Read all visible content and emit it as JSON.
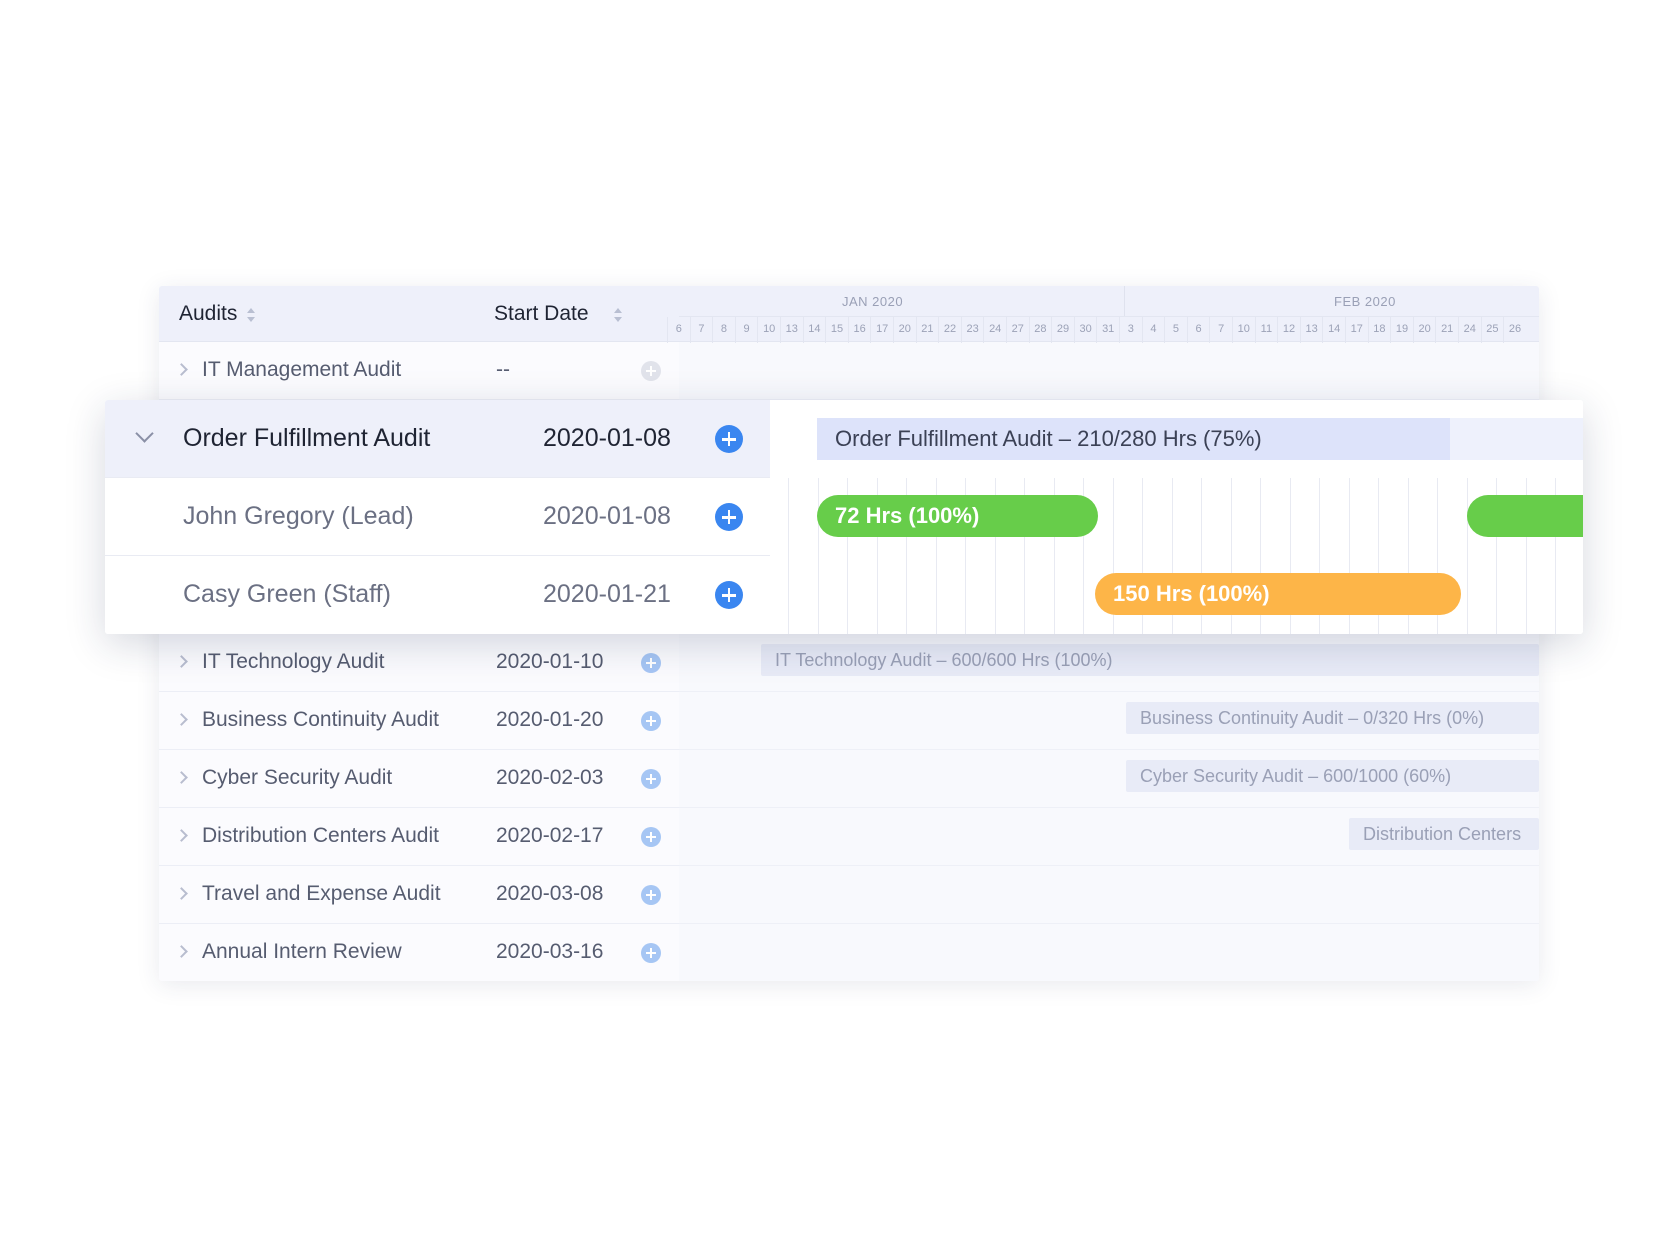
{
  "columns": {
    "audits": "Audits",
    "start_date": "Start Date"
  },
  "timeline": {
    "months": [
      "JAN 2020",
      "FEB 2020"
    ],
    "days": [
      "6",
      "7",
      "8",
      "9",
      "10",
      "13",
      "14",
      "15",
      "16",
      "17",
      "20",
      "21",
      "22",
      "23",
      "24",
      "27",
      "28",
      "29",
      "30",
      "31",
      "3",
      "4",
      "5",
      "6",
      "7",
      "10",
      "11",
      "12",
      "13",
      "14",
      "17",
      "18",
      "19",
      "20",
      "21",
      "24",
      "25",
      "26"
    ]
  },
  "rows_top": [
    {
      "name": "IT Management Audit",
      "date": "--"
    }
  ],
  "expanded": {
    "name": "Order Fulfillment Audit",
    "date": "2020-01-08",
    "summary_bar": "Order Fulfillment Audit – 210/280 Hrs (75%)",
    "children": [
      {
        "name": "John Gregory (Lead)",
        "date": "2020-01-08",
        "bar": "72 Hrs (100%)"
      },
      {
        "name": "Casy Green (Staff)",
        "date": "2020-01-21",
        "bar": "150 Hrs (100%)"
      }
    ]
  },
  "rows_bottom": [
    {
      "name": "IT Technology Audit",
      "date": "2020-01-10",
      "bar": "IT Technology Audit – 600/600 Hrs (100%)"
    },
    {
      "name": "Business Continuity Audit",
      "date": "2020-01-20",
      "bar": "Business Continuity Audit – 0/320 Hrs (0%)"
    },
    {
      "name": "Cyber Security Audit",
      "date": "2020-02-03",
      "bar": "Cyber Security Audit – 600/1000 (60%)"
    },
    {
      "name": "Distribution Centers Audit",
      "date": "2020-02-17",
      "bar": "Distribution Centers"
    },
    {
      "name": "Travel and Expense Audit",
      "date": "2020-03-08",
      "bar": ""
    },
    {
      "name": "Annual Intern Review",
      "date": "2020-03-16",
      "bar": ""
    }
  ],
  "colors": {
    "accent": "#3a86f0",
    "green": "#67cd4a",
    "orange": "#fdb548",
    "header_bg": "#eef0fa"
  },
  "icons": {
    "expand": "chevron-right-icon",
    "collapse": "chevron-down-icon",
    "add": "plus-circle-icon",
    "sort": "sort-icon"
  }
}
